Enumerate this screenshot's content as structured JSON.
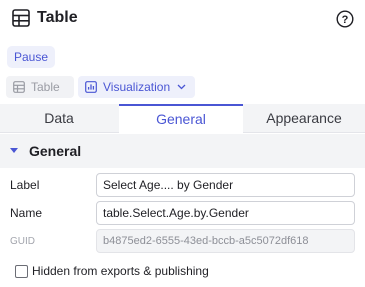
{
  "header": {
    "title": "Table",
    "icon": "table-icon",
    "help_icon": "help-circle-icon"
  },
  "controls": {
    "pause_label": "Pause"
  },
  "view_switch": {
    "table_label": "Table",
    "visualization_label": "Visualization",
    "active": "Visualization"
  },
  "tabs": [
    {
      "label": "Data"
    },
    {
      "label": "General",
      "active": true
    },
    {
      "label": "Appearance"
    }
  ],
  "section": {
    "title": "General",
    "expanded": true
  },
  "fields": {
    "label": {
      "label": "Label",
      "value": "Select Age.... by Gender"
    },
    "name": {
      "label": "Name",
      "value": "table.Select.Age.by.Gender"
    },
    "guid": {
      "label": "GUID",
      "value": "b4875ed2-6555-43ed-bccb-a5c5072df618"
    }
  },
  "options": {
    "hidden_label": "Hidden from exports & publishing",
    "hidden_checked": false
  },
  "colors": {
    "accent": "#4a56d4",
    "tab_bg": "#f3f4f6"
  }
}
